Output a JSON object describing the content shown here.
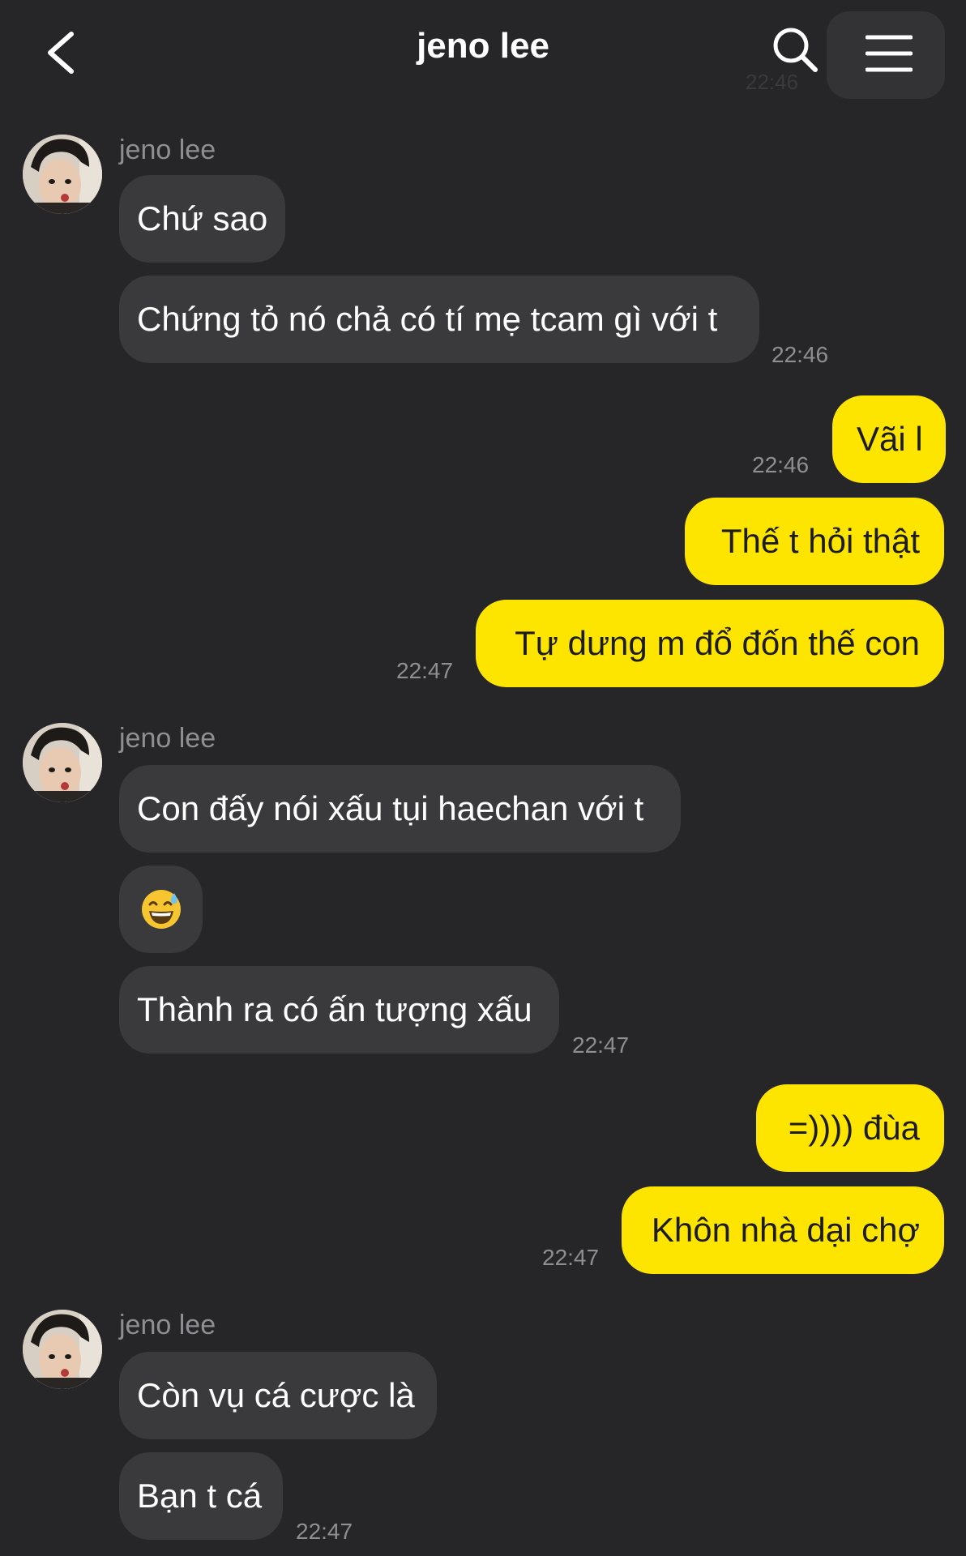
{
  "header": {
    "title": "jeno lee",
    "ghost_time": "22:46"
  },
  "colors": {
    "background": "#262629",
    "incoming_bubble": "#3a3a3d",
    "outgoing_bubble": "#fee500",
    "timestamp": "#8e8e93"
  },
  "messages": [
    {
      "sender": "jeno lee",
      "bubbles": [
        "Chứ sao",
        "Chứng tỏ nó chả có tí mẹ tcam gì với t"
      ],
      "time": "22:46"
    },
    {
      "outgoing": [
        "Vãi l"
      ],
      "time": "22:46"
    },
    {
      "outgoing": [
        "Thế t hỏi thật",
        "Tự dưng m đổ đốn thế con"
      ],
      "time": "22:47"
    },
    {
      "sender": "jeno lee",
      "bubbles": [
        "Con đấy nói xấu tụi haechan với t",
        "sweat-smile-emoji",
        "Thành ra có ấn tượng xấu"
      ],
      "time": "22:47"
    },
    {
      "outgoing": [
        "=)))) đùa",
        "Khôn nhà dại chợ"
      ],
      "time": "22:47"
    },
    {
      "sender": "jeno lee",
      "bubbles": [
        "Còn vụ cá cược là",
        "Bạn t cá"
      ],
      "time": "22:47"
    }
  ]
}
